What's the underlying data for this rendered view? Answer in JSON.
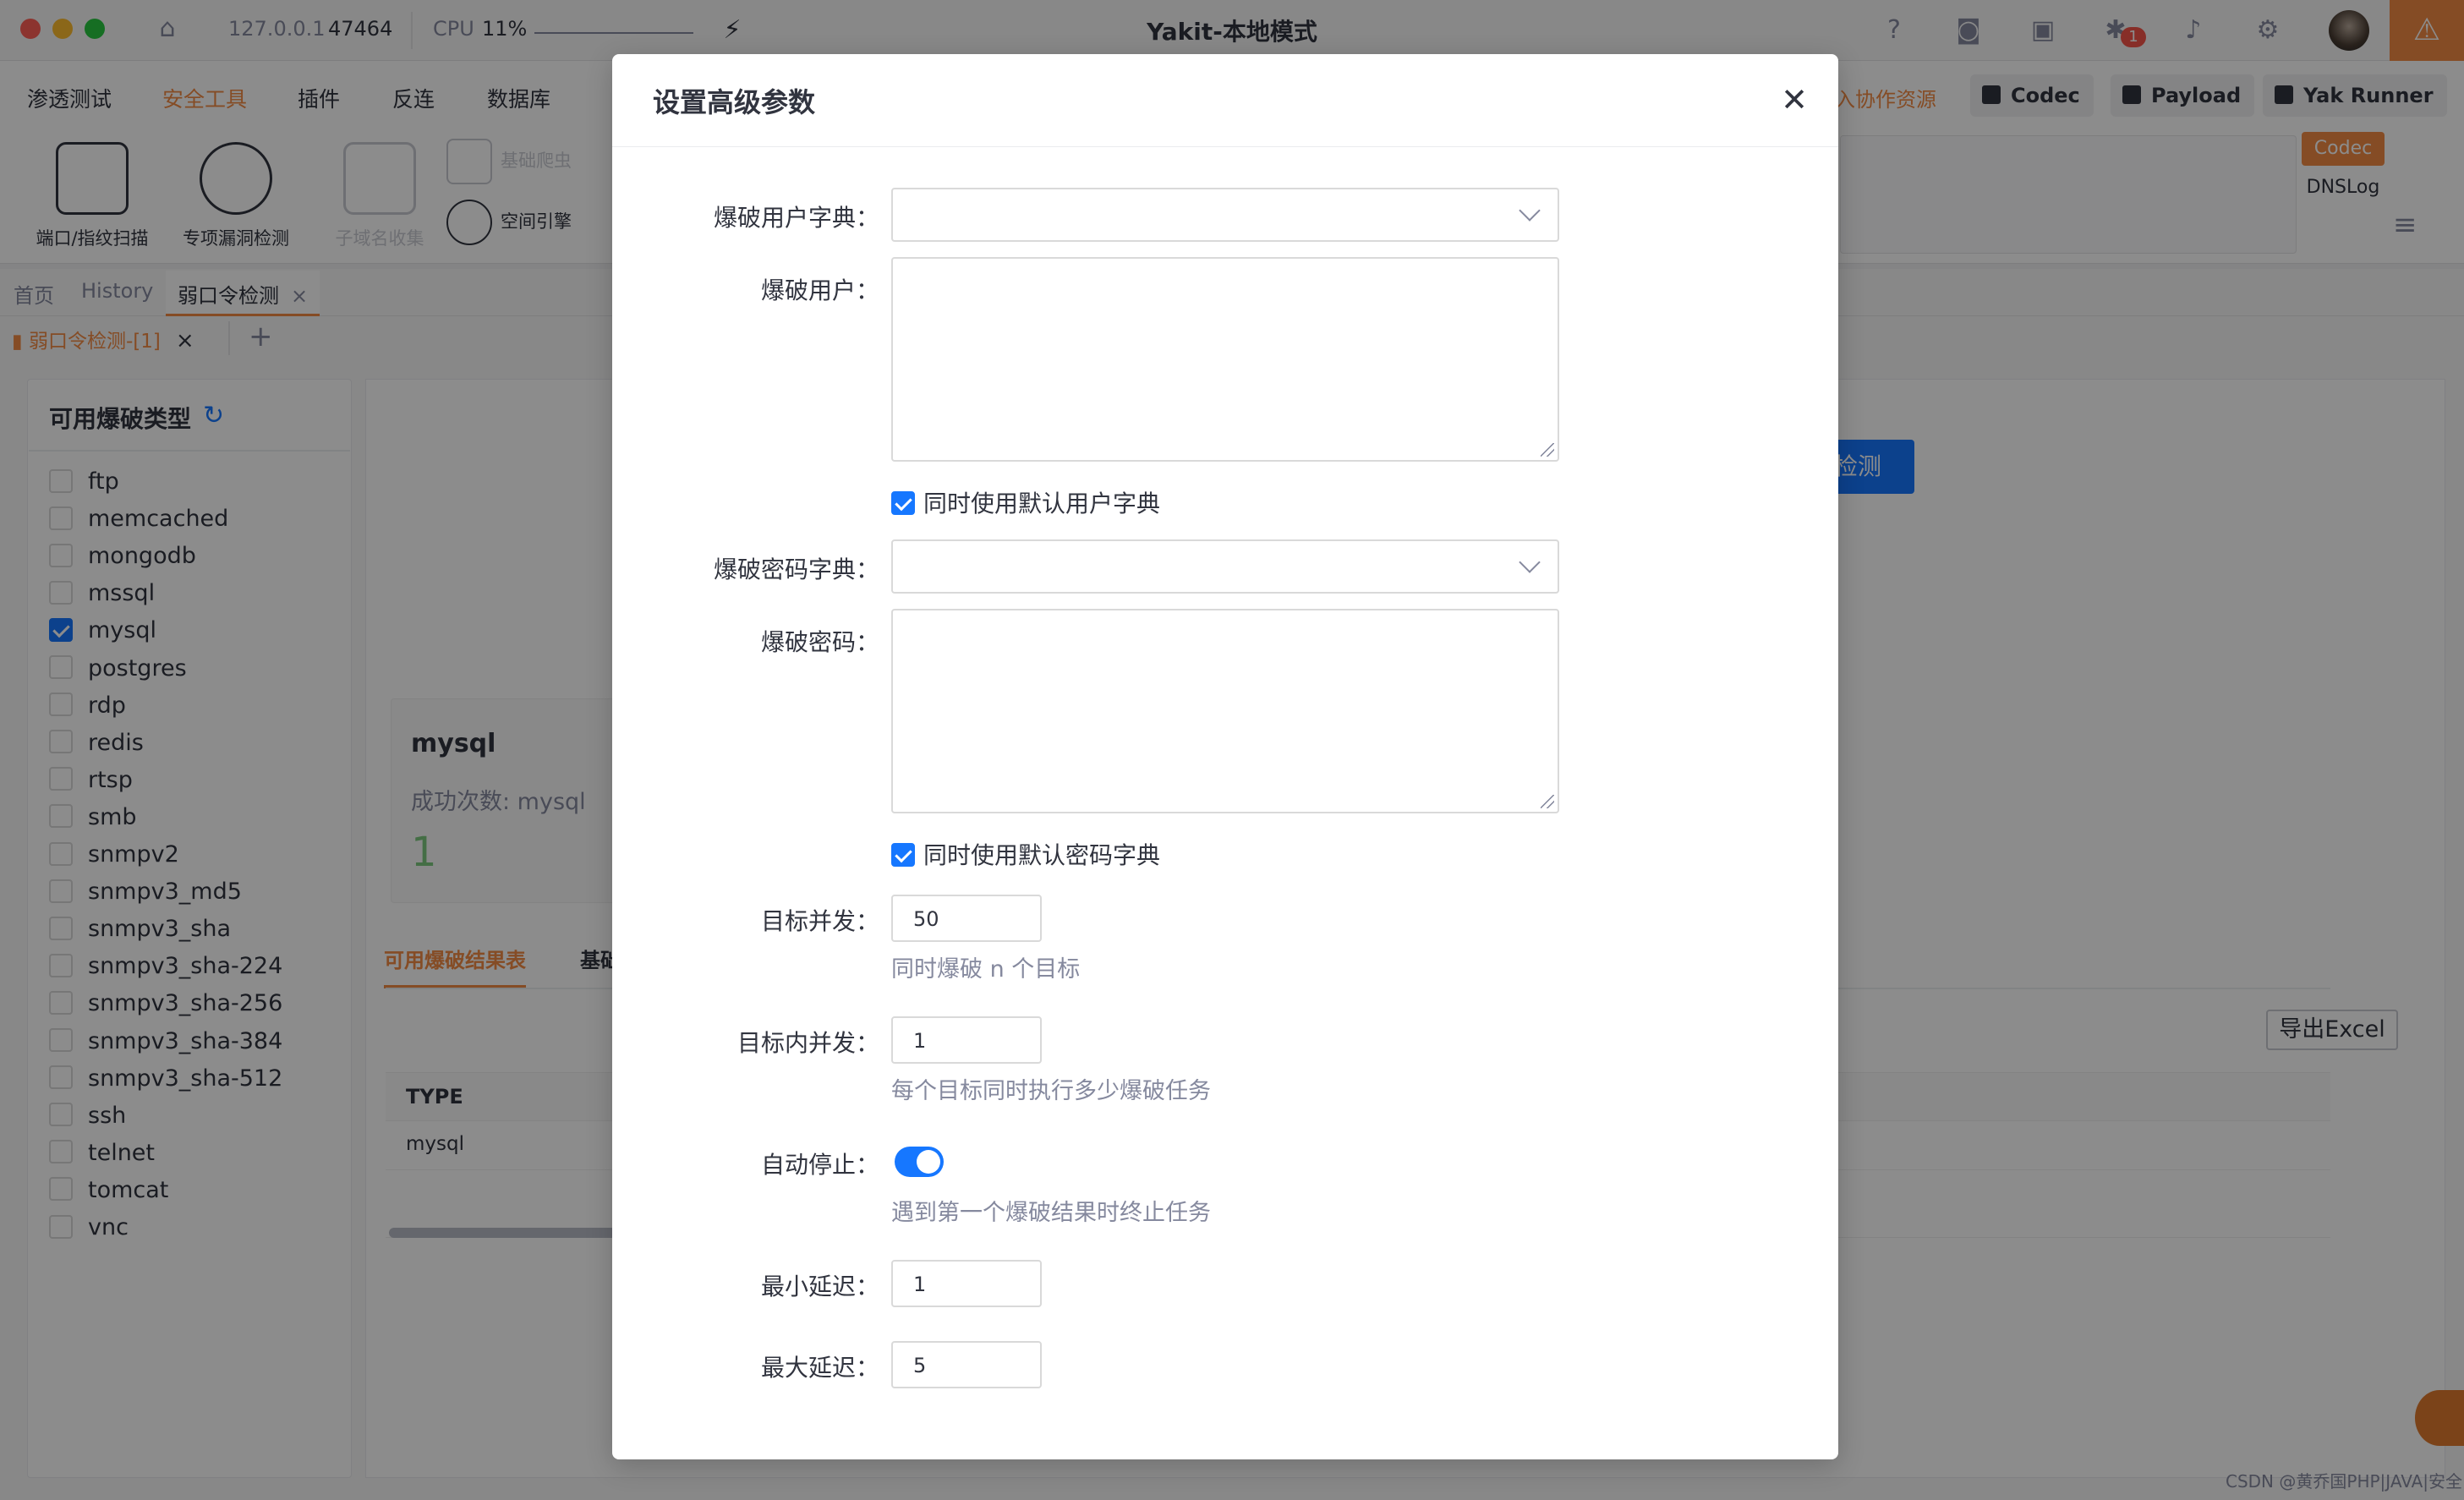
{
  "titlebar": {
    "host": "127.0.0.1",
    "port": "47464",
    "cpu_label": "CPU",
    "cpu_value": "11%",
    "app_title": "Yakit-本地模式",
    "bug_count": "1"
  },
  "menu": {
    "items": [
      "渗透测试",
      "安全工具",
      "插件",
      "反连",
      "数据库"
    ],
    "active": "安全工具",
    "collab_link": "入协作资源",
    "tool_pills": [
      "Codec",
      "Payload",
      "Yak Runner"
    ]
  },
  "toolbar": {
    "tools": [
      {
        "label": "端口/指纹扫描",
        "icon": "fingerprint-icon",
        "disabled": false
      },
      {
        "label": "专项漏洞检测",
        "icon": "bug-scan-icon",
        "disabled": false
      },
      {
        "label": "子域名收集",
        "icon": "clipboard-icon",
        "disabled": true
      }
    ],
    "small_tools": [
      {
        "label": "基础爬虫",
        "icon": "crawler-icon",
        "disabled": true
      },
      {
        "label": "空间引擎",
        "icon": "space-engine-icon",
        "disabled": false
      }
    ],
    "codec_tag": "Codec",
    "dnslog_tag": "DNSLog"
  },
  "page_tabs": {
    "items": [
      "首页",
      "History",
      "弱口令检测"
    ],
    "active": "弱口令检测"
  },
  "sub_tabs": {
    "active": "弱口令检测-[1]"
  },
  "left_panel": {
    "title": "可用爆破类型",
    "types": [
      {
        "name": "ftp",
        "checked": false
      },
      {
        "name": "memcached",
        "checked": false
      },
      {
        "name": "mongodb",
        "checked": false
      },
      {
        "name": "mssql",
        "checked": false
      },
      {
        "name": "mysql",
        "checked": true
      },
      {
        "name": "postgres",
        "checked": false
      },
      {
        "name": "rdp",
        "checked": false
      },
      {
        "name": "redis",
        "checked": false
      },
      {
        "name": "rtsp",
        "checked": false
      },
      {
        "name": "smb",
        "checked": false
      },
      {
        "name": "snmpv2",
        "checked": false
      },
      {
        "name": "snmpv3_md5",
        "checked": false
      },
      {
        "name": "snmpv3_sha",
        "checked": false
      },
      {
        "name": "snmpv3_sha-224",
        "checked": false
      },
      {
        "name": "snmpv3_sha-256",
        "checked": false
      },
      {
        "name": "snmpv3_sha-384",
        "checked": false
      },
      {
        "name": "snmpv3_sha-512",
        "checked": false
      },
      {
        "name": "ssh",
        "checked": false
      },
      {
        "name": "telnet",
        "checked": false
      },
      {
        "name": "tomcat",
        "checked": false
      },
      {
        "name": "vnc",
        "checked": false
      }
    ]
  },
  "results": {
    "card_title": "mysql",
    "card_sub": "成功次数: mysql",
    "card_count": "1",
    "tab_available": "可用爆破结果表",
    "tab_basic": "基础",
    "export_label": "导出Excel",
    "detect_label": "检测",
    "table_header": "TYPE",
    "table_row": "mysql"
  },
  "modal": {
    "title": "设置高级参数",
    "user_dict_label": "爆破用户字典",
    "user_label": "爆破用户",
    "use_default_user_dict": "同时使用默认用户字典",
    "pass_dict_label": "爆破密码字典",
    "pass_label": "爆破密码",
    "use_default_pass_dict": "同时使用默认密码字典",
    "target_concurrency_label": "目标并发",
    "target_concurrency_value": "50",
    "target_concurrency_help": "同时爆破 n 个目标",
    "inner_concurrency_label": "目标内并发",
    "inner_concurrency_value": "1",
    "inner_concurrency_help": "每个目标同时执行多少爆破任务",
    "auto_stop_label": "自动停止",
    "auto_stop_on": true,
    "auto_stop_help": "遇到第一个爆破结果时终止任务",
    "min_delay_label": "最小延迟",
    "min_delay_value": "1",
    "max_delay_label": "最大延迟",
    "max_delay_value": "5"
  },
  "watermark": "CSDN @黄乔国PHP|JAVA|安全",
  "colors": {
    "accent": "#f28b44",
    "primary": "#1677ff",
    "success": "#7cc97f"
  }
}
